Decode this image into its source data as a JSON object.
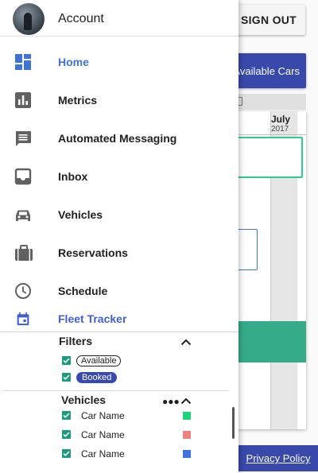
{
  "header": {
    "signout_label": "SIGN OUT"
  },
  "main": {
    "available_cars_label": "Available Cars",
    "calendar": {
      "month": "July",
      "year": "2017"
    },
    "privacy_label": "Privacy Policy"
  },
  "drawer": {
    "account_label": "Account",
    "nav": [
      {
        "label": "Home",
        "icon": "dashboard-icon",
        "active": true
      },
      {
        "label": "Metrics",
        "icon": "bar-chart-icon"
      },
      {
        "label": "Automated Messaging",
        "icon": "message-icon"
      },
      {
        "label": "Inbox",
        "icon": "inbox-icon"
      },
      {
        "label": "Vehicles",
        "icon": "car-icon"
      },
      {
        "label": "Reservations",
        "icon": "briefcase-icon"
      },
      {
        "label": "Schedule",
        "icon": "clock-icon"
      },
      {
        "label": "Fleet Tracker",
        "icon": "calendar-icon"
      }
    ],
    "filters": {
      "title": "Filters",
      "items": [
        {
          "label": "Available",
          "checked": true
        },
        {
          "label": "Booked",
          "checked": true
        }
      ]
    },
    "vehicles": {
      "title": "Vehicles",
      "items": [
        {
          "name": "Car Name",
          "checked": true,
          "color": "#1ed47a"
        },
        {
          "name": "Car Name",
          "checked": true,
          "color": "#f08080"
        },
        {
          "name": "Car Name",
          "checked": true,
          "color": "#3f73e0"
        }
      ]
    }
  },
  "colors": {
    "accent": "#3f73d6",
    "primary": "#3949ab",
    "checkbox": "#1c9a7b"
  }
}
